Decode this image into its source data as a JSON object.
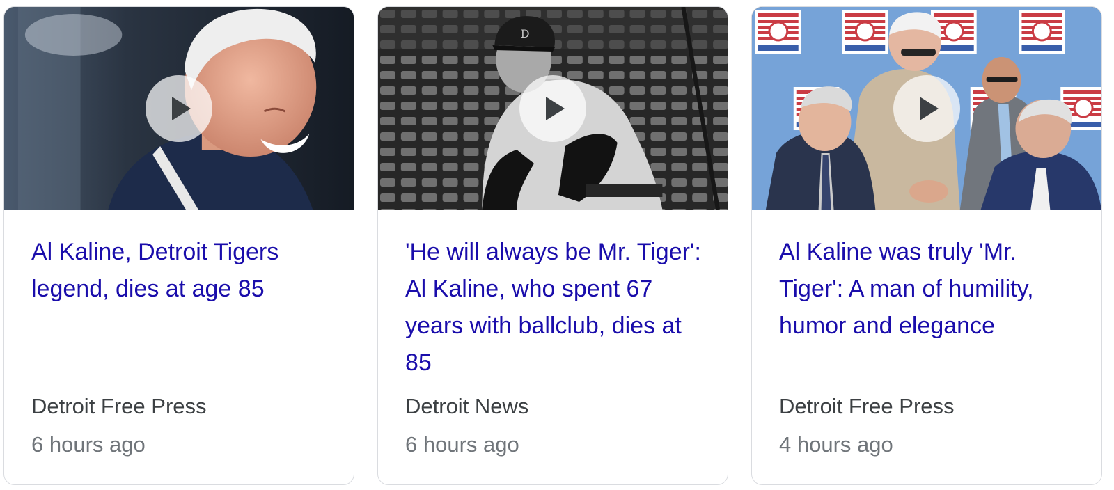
{
  "cards": [
    {
      "headline": "Al Kaline, Detroit Tigers legend, dies at age 85",
      "source": "Detroit Free Press",
      "time": "6 hours ago",
      "thumbnail": "video-thumbnail-smiling-man",
      "icon": "play-icon"
    },
    {
      "headline": "'He will always be Mr. Tiger': Al Kaline, who spent 67 years with ballclub, dies at 85",
      "source": "Detroit News",
      "time": "6 hours ago",
      "thumbnail": "video-thumbnail-baseball-player-bw",
      "icon": "play-icon"
    },
    {
      "headline": "Al Kaline was truly 'Mr. Tiger': A man of humility, humor and elegance",
      "source": "Detroit Free Press",
      "time": "4 hours ago",
      "thumbnail": "video-thumbnail-hall-of-fame-ceremony",
      "icon": "play-icon"
    }
  ],
  "colors": {
    "headline": "#1a0dab",
    "source": "#3c4043",
    "time": "#70757a",
    "card_border": "#dadce0"
  }
}
